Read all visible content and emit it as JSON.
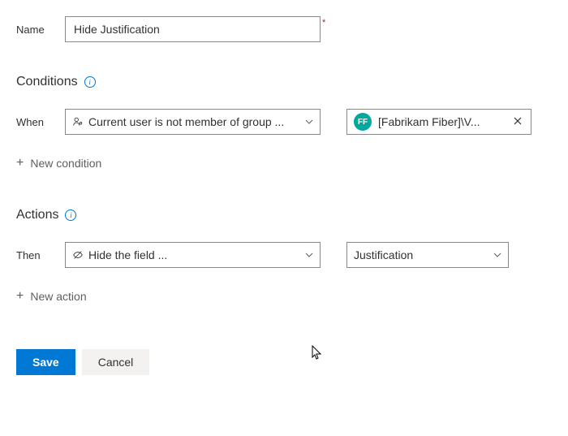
{
  "name": {
    "label": "Name",
    "value": "Hide Justification"
  },
  "conditions": {
    "heading": "Conditions",
    "whenLabel": "When",
    "whenValue": "Current user is not member of group ...",
    "group": {
      "avatar": "FF",
      "text": "[Fabrikam Fiber]\\V..."
    },
    "addLabel": "New condition"
  },
  "actions": {
    "heading": "Actions",
    "thenLabel": "Then",
    "thenValue": "Hide the field ...",
    "fieldValue": "Justification",
    "addLabel": "New action"
  },
  "footer": {
    "save": "Save",
    "cancel": "Cancel"
  }
}
